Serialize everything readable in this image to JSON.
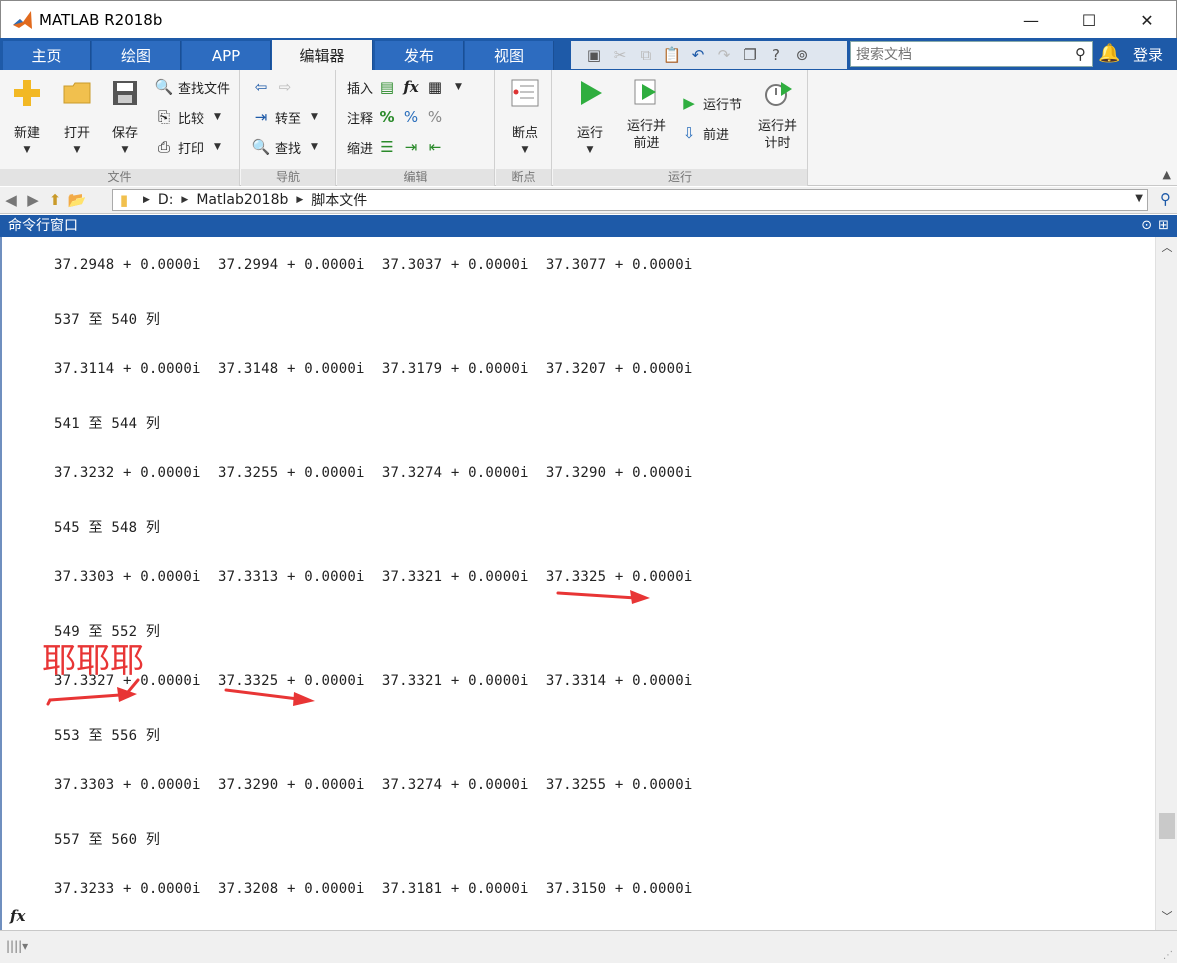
{
  "window": {
    "title": "MATLAB R2018b",
    "minimize": "—",
    "maximize": "☐",
    "close": "✕"
  },
  "tabs": [
    {
      "label": "主页"
    },
    {
      "label": "绘图"
    },
    {
      "label": "APP"
    },
    {
      "label": "编辑器"
    },
    {
      "label": "发布"
    },
    {
      "label": "视图"
    }
  ],
  "search": {
    "placeholder": "搜索文档"
  },
  "login_label": "登录",
  "ribbon": {
    "file": {
      "label": "文件",
      "new": "新建",
      "open": "打开",
      "save": "保存",
      "find_files": "查找文件",
      "compare": "比较",
      "print": "打印"
    },
    "navigate": {
      "label": "导航",
      "goto": "转至",
      "find": "查找"
    },
    "edit": {
      "label": "编辑",
      "insert": "插入",
      "comment": "注释",
      "indent": "缩进"
    },
    "breakpoints": {
      "label": "断点",
      "breakpoints": "断点"
    },
    "run": {
      "label": "运行",
      "run": "运行",
      "run_advance": "运行并\n前进",
      "run_section": "运行节",
      "advance": "前进",
      "run_time": "运行并\n计时"
    }
  },
  "address": {
    "segments": [
      "D:",
      "Matlab2018b",
      "脚本文件"
    ]
  },
  "command_window": {
    "title": "命令行窗口",
    "lines": [
      "37.2948 + 0.0000i  37.2994 + 0.0000i  37.3037 + 0.0000i  37.3077 + 0.0000i",
      "537 至 540 列",
      "37.3114 + 0.0000i  37.3148 + 0.0000i  37.3179 + 0.0000i  37.3207 + 0.0000i",
      "541 至 544 列",
      "37.3232 + 0.0000i  37.3255 + 0.0000i  37.3274 + 0.0000i  37.3290 + 0.0000i",
      "545 至 548 列",
      "37.3303 + 0.0000i  37.3313 + 0.0000i  37.3321 + 0.0000i  37.3325 + 0.0000i",
      "549 至 552 列",
      "37.3327 + 0.0000i  37.3325 + 0.0000i  37.3321 + 0.0000i  37.3314 + 0.0000i",
      "553 至 556 列",
      "37.3303 + 0.0000i  37.3290 + 0.0000i  37.3274 + 0.0000i  37.3255 + 0.0000i",
      "557 至 560 列",
      "37.3233 + 0.0000i  37.3208 + 0.0000i  37.3181 + 0.0000i  37.3150 + 0.0000i"
    ],
    "prompt": "fx"
  },
  "annotation": {
    "text": "耶耶耶",
    "color": "#e83535"
  }
}
